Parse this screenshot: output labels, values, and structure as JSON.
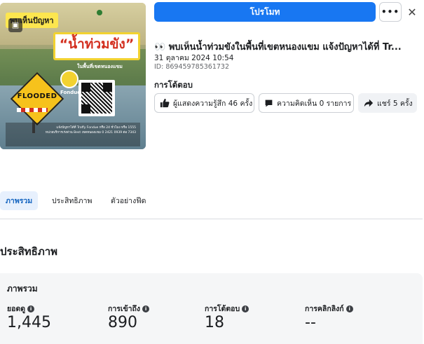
{
  "thumbnail": {
    "top_badge": "พบเห็นปัญหา",
    "headline": "“น้ำท่วมขัง”",
    "subheadline": "ในพื้นที่เขตหนองแขม",
    "flooded_sign": "FLOODED",
    "fondue_label": "Fondue",
    "footer_line1": "แจ้งปัญหาได้ที่ Traffy Fondue หรือ 24 ชั่วโมง หรือ 1555",
    "footer_line2": "หน่วยบริการเร่งด่วน Best เขตหนองแขม 0 2421 0939 ต่อ 7343"
  },
  "header": {
    "promote_label": "โปรโมท",
    "more_label": "•••",
    "close_label": "✕"
  },
  "post": {
    "title": "👀 พบเห็นน้ำท่วมขังในพื้นที่เขตหนองแขม แจ้งปัญหาได้ที่ Tr...",
    "date": "31 ตุลาคม 2024 10:54",
    "id": "ID: 869459785361732"
  },
  "engagement": {
    "heading": "การโต้ตอบ",
    "reactions_label": "ผู้แสดงความรู้สึก 46 ครั้ง",
    "comments_label": "ความคิดเห็น 0 รายการ",
    "shares_label": "แชร์ 5 ครั้ง"
  },
  "tabs": [
    {
      "label": "ภาพรวม"
    },
    {
      "label": "ประสิทธิภาพ"
    },
    {
      "label": "ตัวอย่างฟีด"
    }
  ],
  "performance": {
    "section_title": "ประสิทธิภาพ",
    "card_title": "ภาพรวม",
    "metrics": [
      {
        "label": "ยอดดู",
        "value": "1,445"
      },
      {
        "label": "การเข้าถึง",
        "value": "890"
      },
      {
        "label": "การโต้ตอบ",
        "value": "18"
      },
      {
        "label": "การคลิกลิงก์",
        "value": "--"
      }
    ]
  },
  "colors": {
    "accent": "#1877f2",
    "tab_active_bg": "#e7f0fd",
    "card_bg": "#f5f6f7"
  },
  "icons": {
    "reactions": "thumbs-up-icon",
    "comments": "comment-icon",
    "shares": "share-icon",
    "info": "info-icon"
  }
}
